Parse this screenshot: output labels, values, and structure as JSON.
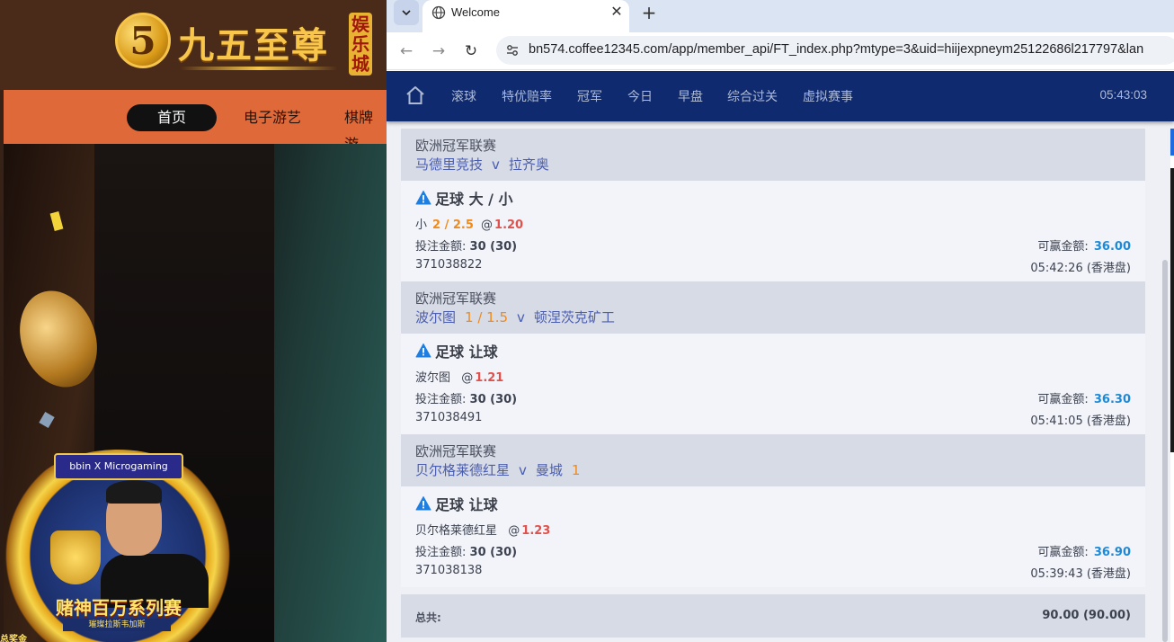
{
  "background_site": {
    "logo_glyph": "5",
    "logo_text": "九五至尊",
    "logo_tag": "娱乐城",
    "nav": [
      "首页",
      "电子游艺",
      "棋牌游"
    ],
    "badge_brand": "bbin X Microgaming",
    "badge_title": "赌神百万系列赛",
    "badge_sub": "璀璨拉斯韦加斯",
    "badge_foot": "总奖金"
  },
  "browser": {
    "tab_title": "Welcome",
    "tab_close": "✕",
    "new_tab": "+",
    "url": "bn574.coffee12345.com/app/member_api/FT_index.php?mtype=3&uid=hiijexpneym25122686l217797&lan",
    "back_icon": "←",
    "forward_icon": "→",
    "reload_icon": "↻"
  },
  "app": {
    "nav_items": [
      "滚球",
      "特优赔率",
      "冠军",
      "今日",
      "早盘",
      "综合过关",
      "虚拟赛事"
    ],
    "clock": "05:43:03"
  },
  "bets": [
    {
      "league": "欧洲冠军联赛",
      "home": "马德里竞技",
      "home_hcp": "",
      "vs": "v",
      "away": "拉齐奥",
      "away_hcp": "",
      "bet_type": "足球 大 / 小",
      "selection": "小",
      "line": "2 / 2.5",
      "at": "@",
      "odds": "1.20",
      "stake_label": "投注金额:",
      "stake": "30 (30)",
      "win_label": "可赢金额:",
      "win": "36.00",
      "ticket": "371038822",
      "time": "05:42:26 (香港盘)"
    },
    {
      "league": "欧洲冠军联赛",
      "home": "波尔图",
      "home_hcp": "1 / 1.5",
      "vs": "v",
      "away": "顿涅茨克矿工",
      "away_hcp": "",
      "bet_type": "足球 让球",
      "selection": "波尔图",
      "line": "",
      "at": "@",
      "odds": "1.21",
      "stake_label": "投注金额:",
      "stake": "30 (30)",
      "win_label": "可赢金额:",
      "win": "36.30",
      "ticket": "371038491",
      "time": "05:41:05 (香港盘)"
    },
    {
      "league": "欧洲冠军联赛",
      "home": "贝尔格莱德红星",
      "home_hcp": "",
      "vs": "v",
      "away": "曼城",
      "away_hcp": "1",
      "bet_type": "足球 让球",
      "selection": "贝尔格莱德红星",
      "line": "",
      "at": "@",
      "odds": "1.23",
      "stake_label": "投注金额:",
      "stake": "30 (30)",
      "win_label": "可赢金额:",
      "win": "36.90",
      "ticket": "371038138",
      "time": "05:39:43 (香港盘)"
    }
  ],
  "total": {
    "label": "总共:",
    "value": "90.00 (90.00)"
  },
  "colors": {
    "nav_bg": "#0f2a6e",
    "handicap": "#ef8a1c",
    "odds": "#e2504b",
    "win": "#1e8ad6",
    "warning_icon": "#1e7fe0"
  },
  "icons": {
    "home": "home-icon",
    "warning": "warning-icon",
    "site_info": "tune-icon",
    "favicon": "globe-icon"
  }
}
